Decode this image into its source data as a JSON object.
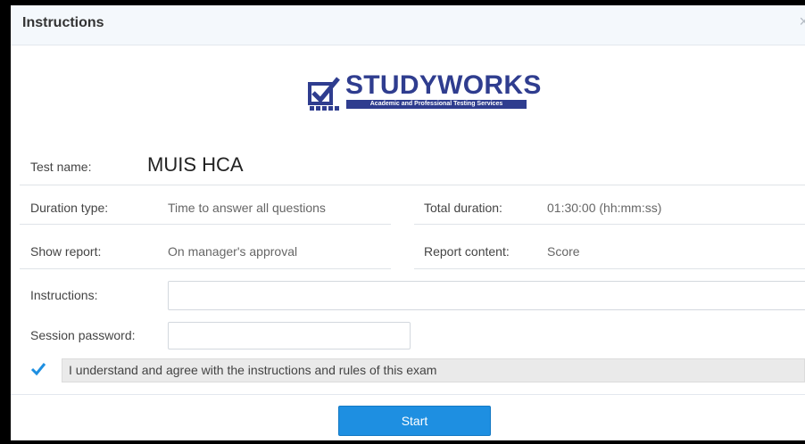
{
  "dialog": {
    "title": "Instructions",
    "close_symbol": "×"
  },
  "logo": {
    "name": "STUDYWORKS",
    "tagline": "Academic and Professional Testing Services",
    "icon": "checkbox-check-icon"
  },
  "test": {
    "label": "Test name:",
    "value": "MUIS HCA"
  },
  "details": {
    "duration_type": {
      "label": "Duration type:",
      "value": "Time to answer all questions"
    },
    "total_duration": {
      "label": "Total duration:",
      "value": "01:30:00 (hh:mm:ss)"
    },
    "show_report": {
      "label": "Show report:",
      "value": "On manager's approval"
    },
    "report_content": {
      "label": "Report content:",
      "value": "Score"
    }
  },
  "instructions": {
    "label": "Instructions:",
    "value": ""
  },
  "session_password": {
    "label": "Session password:",
    "value": ""
  },
  "agree": {
    "checked": true,
    "text": "I understand and agree with the instructions and rules of this exam"
  },
  "start_button": {
    "label": "Start"
  },
  "colors": {
    "primary": "#1e8fe1",
    "logo": "#2f3d8f",
    "check": "#1e8fe1"
  }
}
